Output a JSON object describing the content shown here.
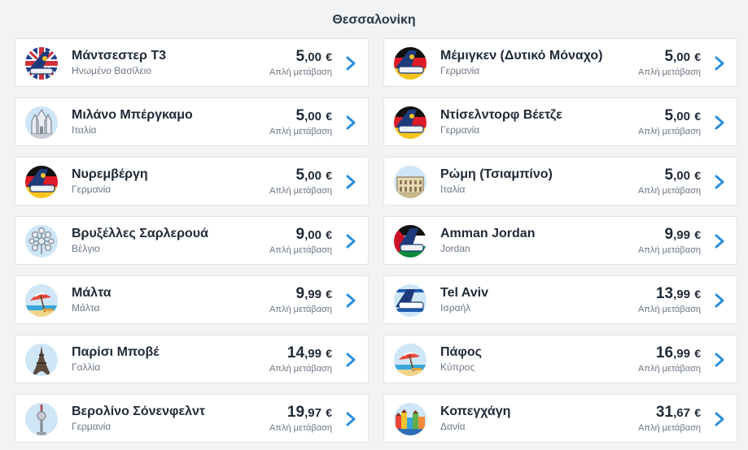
{
  "page": {
    "title": "Θεσσαλονίκη"
  },
  "colors": {
    "accent": "#2a8fde",
    "text": "#1f2a37",
    "muted": "#6b7785"
  },
  "destinations": [
    {
      "name": "Μάντσεστερ T3",
      "country": "Ηνωμένο Βασίλειο",
      "price_int": "5",
      "price_dec": ",00",
      "currency": "€",
      "note": "Απλή μετάβαση",
      "icon": "uk-flag-plane-icon"
    },
    {
      "name": "Μέμιγκεν (Δυτικό Μόναχο)",
      "country": "Γερμανία",
      "price_int": "5",
      "price_dec": ",00",
      "currency": "€",
      "note": "Απλή μετάβαση",
      "icon": "germany-flag-plane-icon"
    },
    {
      "name": "Μιλάνο Μπέργκαμο",
      "country": "Ιταλία",
      "price_int": "5",
      "price_dec": ",00",
      "currency": "€",
      "note": "Απλή μετάβαση",
      "icon": "milan-cathedral-icon"
    },
    {
      "name": "Ντίσελντορφ Βέετζε",
      "country": "Γερμανία",
      "price_int": "5",
      "price_dec": ",00",
      "currency": "€",
      "note": "Απλή μετάβαση",
      "icon": "germany-flag-plane-icon"
    },
    {
      "name": "Νυρεμβέργη",
      "country": "Γερμανία",
      "price_int": "5",
      "price_dec": ",00",
      "currency": "€",
      "note": "Απλή μετάβαση",
      "icon": "germany-flag-plane-icon"
    },
    {
      "name": "Ρώμη (Τσιαμπίνο)",
      "country": "Ιταλία",
      "price_int": "5",
      "price_dec": ",00",
      "currency": "€",
      "note": "Απλή μετάβαση",
      "icon": "colosseum-icon"
    },
    {
      "name": "Βρυξέλλες Σαρλερουά",
      "country": "Βέλγιο",
      "price_int": "9",
      "price_dec": ",00",
      "currency": "€",
      "note": "Απλή μετάβαση",
      "icon": "atomium-icon"
    },
    {
      "name": "Amman Jordan",
      "country": "Jordan",
      "price_int": "9",
      "price_dec": ",99",
      "currency": "€",
      "note": "Απλή μετάβαση",
      "icon": "jordan-flag-plane-icon"
    },
    {
      "name": "Μάλτα",
      "country": "Μάλτα",
      "price_int": "9",
      "price_dec": ",99",
      "currency": "€",
      "note": "Απλή μετάβαση",
      "icon": "beach-umbrella-icon"
    },
    {
      "name": "Tel Aviv",
      "country": "Ισραήλ",
      "price_int": "13",
      "price_dec": ",99",
      "currency": "€",
      "note": "Απλή μετάβαση",
      "icon": "israel-flag-plane-icon"
    },
    {
      "name": "Παρίσι Μποβέ",
      "country": "Γαλλία",
      "price_int": "14",
      "price_dec": ",99",
      "currency": "€",
      "note": "Απλή μετάβαση",
      "icon": "eiffel-tower-icon"
    },
    {
      "name": "Πάφος",
      "country": "Κύπρος",
      "price_int": "16",
      "price_dec": ",99",
      "currency": "€",
      "note": "Απλή μετάβαση",
      "icon": "beach-umbrella-icon"
    },
    {
      "name": "Βερολίνο Σόνενφελντ",
      "country": "Γερμανία",
      "price_int": "19",
      "price_dec": ",97",
      "currency": "€",
      "note": "Απλή μετάβαση",
      "icon": "tv-tower-icon"
    },
    {
      "name": "Κοπεγχάγη",
      "country": "Δανία",
      "price_int": "31",
      "price_dec": ",67",
      "currency": "€",
      "note": "Απλή μετάβαση",
      "icon": "nyhavn-houses-icon"
    }
  ]
}
